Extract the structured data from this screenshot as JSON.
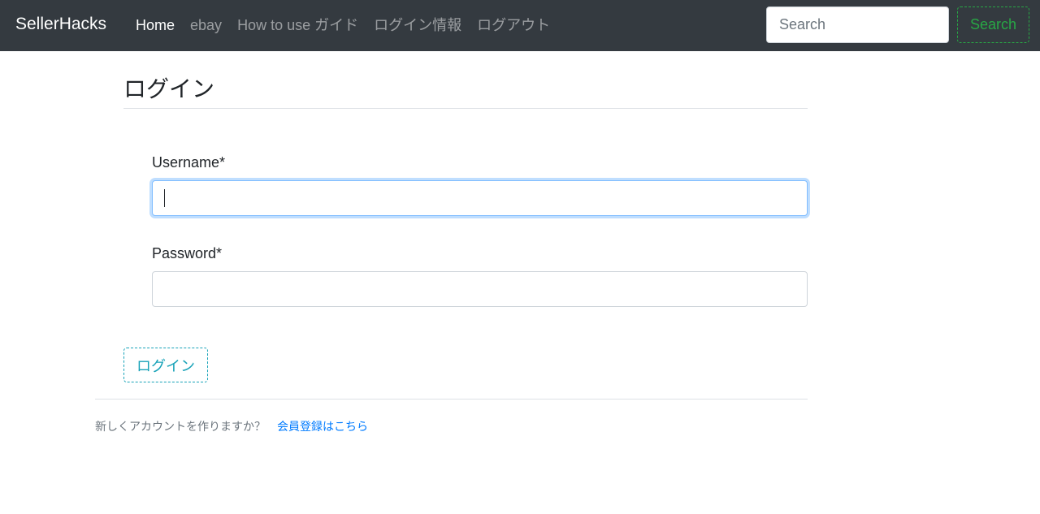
{
  "navbar": {
    "brand": "SellerHacks",
    "links": [
      {
        "label": "Home",
        "active": true
      },
      {
        "label": "ebay",
        "active": false
      },
      {
        "label": "How to use ガイド",
        "active": false
      },
      {
        "label": "ログイン情報",
        "active": false
      },
      {
        "label": "ログアウト",
        "active": false
      }
    ],
    "search_placeholder": "Search",
    "search_value": "",
    "search_button_label": "Search"
  },
  "main": {
    "title": "ログイン",
    "username": {
      "label": "Username*",
      "value": "",
      "focused": true
    },
    "password": {
      "label": "Password*",
      "value": ""
    },
    "login_button_label": "ログイン"
  },
  "footer": {
    "signup_prompt": "新しくアカウントを作りますか？",
    "signup_link": "会員登録はこちら"
  },
  "colors": {
    "navbar_bg": "#343a40",
    "search_button": "#28a745",
    "login_button": "#17a2b8",
    "link": "#007bff",
    "focus_border": "#80bdff"
  }
}
